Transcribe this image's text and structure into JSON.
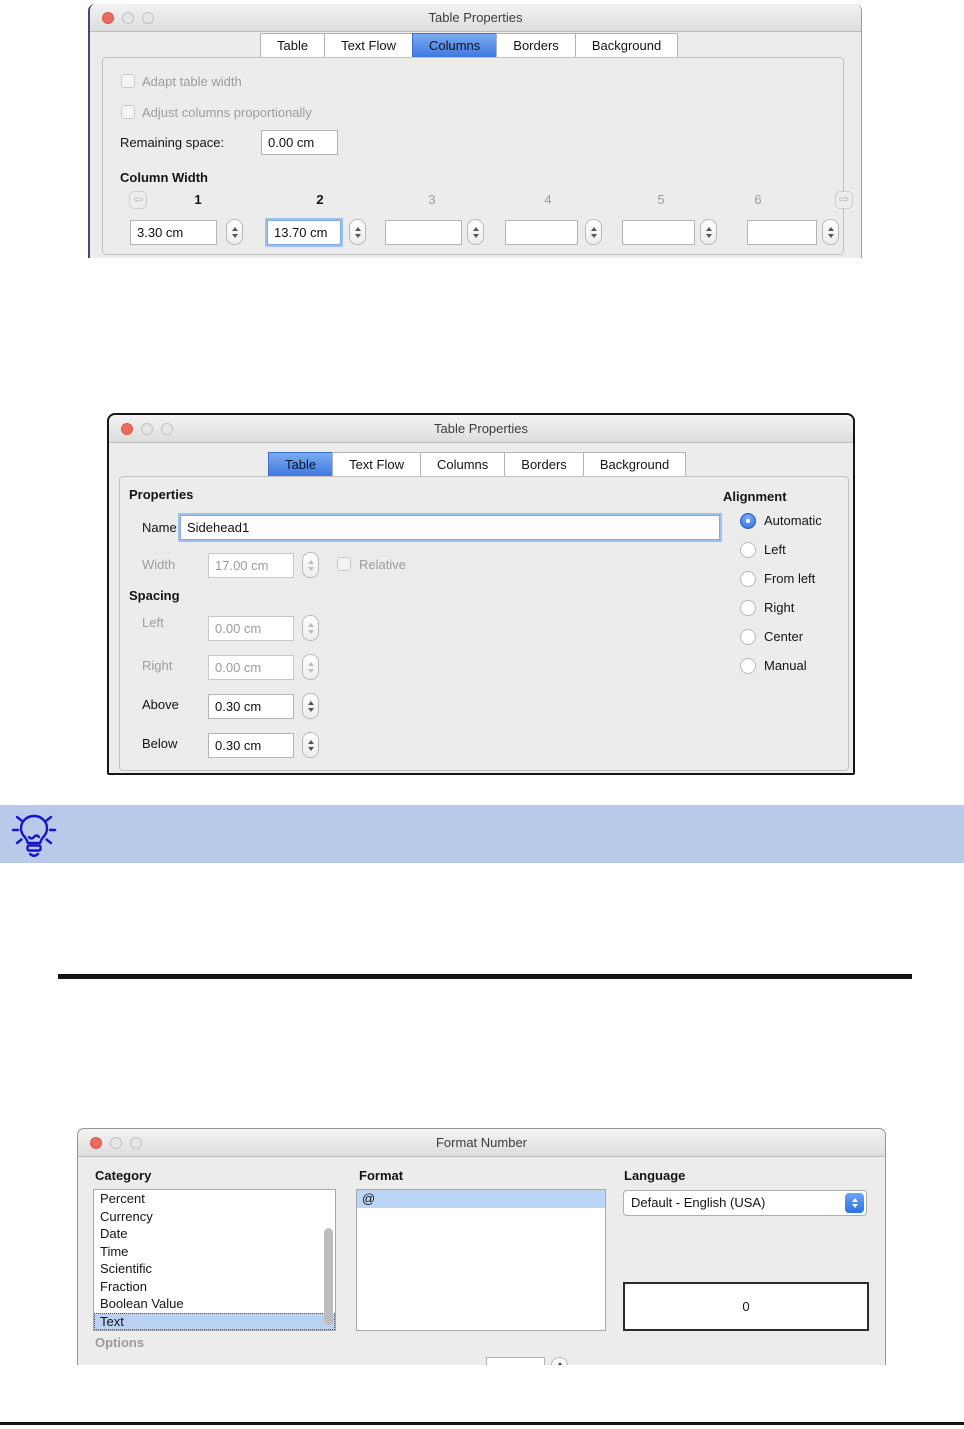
{
  "columns_dialog": {
    "title": "Table Properties",
    "tabs": [
      "Table",
      "Text Flow",
      "Columns",
      "Borders",
      "Background"
    ],
    "selected_tab": "Columns",
    "adapt_checkbox_label": "Adapt table width",
    "adjust_checkbox_label": "Adjust columns proportionally",
    "remaining_space_label": "Remaining space:",
    "remaining_space_value": "0.00 cm",
    "column_width_header": "Column Width",
    "column_numbers": [
      "1",
      "2",
      "3",
      "4",
      "5",
      "6"
    ],
    "column_values": [
      "3.30 cm",
      "13.70 cm",
      "",
      "",
      "",
      ""
    ]
  },
  "table_dialog": {
    "title": "Table Properties",
    "tabs": [
      "Table",
      "Text Flow",
      "Columns",
      "Borders",
      "Background"
    ],
    "selected_tab": "Table",
    "properties_header": "Properties",
    "name_label": "Name",
    "name_value": "Sidehead1",
    "width_label": "Width",
    "width_value": "17.00 cm",
    "relative_label": "Relative",
    "spacing_header": "Spacing",
    "spacing_rows": [
      {
        "label": "Left",
        "value": "0.00 cm"
      },
      {
        "label": "Right",
        "value": "0.00 cm"
      },
      {
        "label": "Above",
        "value": "0.30 cm"
      },
      {
        "label": "Below",
        "value": "0.30 cm"
      }
    ],
    "alignment_header": "Alignment",
    "alignment_options": [
      "Automatic",
      "Left",
      "From left",
      "Right",
      "Center",
      "Manual"
    ],
    "alignment_selected": "Automatic"
  },
  "format_number_dialog": {
    "title": "Format Number",
    "category_header": "Category",
    "categories": [
      "Percent",
      "Currency",
      "Date",
      "Time",
      "Scientific",
      "Fraction",
      "Boolean Value",
      "Text"
    ],
    "selected_category": "Text",
    "format_header": "Format",
    "format_codes": [
      "@"
    ],
    "selected_format": "@",
    "language_header": "Language",
    "language_value": "Default - English (USA)",
    "preview_value": "0",
    "options_header": "Options"
  },
  "colors": {
    "selected_tab_blue": "#4a84e4",
    "list_selection_blue": "#bcd4f6",
    "tip_banner_blue": "#b9c9e9",
    "lightbulb_blue": "#1515cd",
    "close_button_red": "#ee6a5f",
    "radio_selected_blue": "#2d6ce2",
    "focus_ring_blue": "#9cc0ef"
  }
}
